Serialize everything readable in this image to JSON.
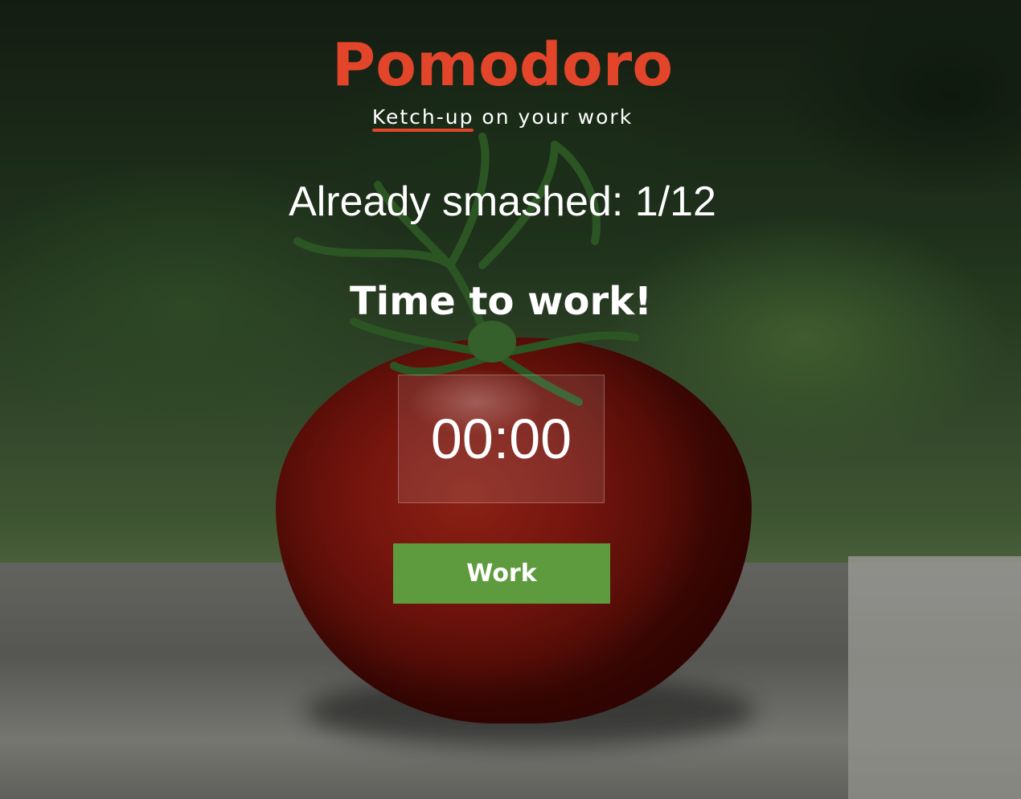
{
  "app": {
    "title": "Pomodoro",
    "tagline_highlight": "Ketch-up",
    "tagline_rest": " on your work"
  },
  "progress": {
    "text": "Already smashed: 1/12",
    "completed": 1,
    "total": 12
  },
  "phase": {
    "text": "Time to work!"
  },
  "timer": {
    "display": "00:00"
  },
  "controls": {
    "work_label": "Work"
  },
  "colors": {
    "brand": "#e2452a",
    "button": "#5e9a3e",
    "text": "#ffffff"
  },
  "background": {
    "subject": "tomato on stone ledge"
  }
}
